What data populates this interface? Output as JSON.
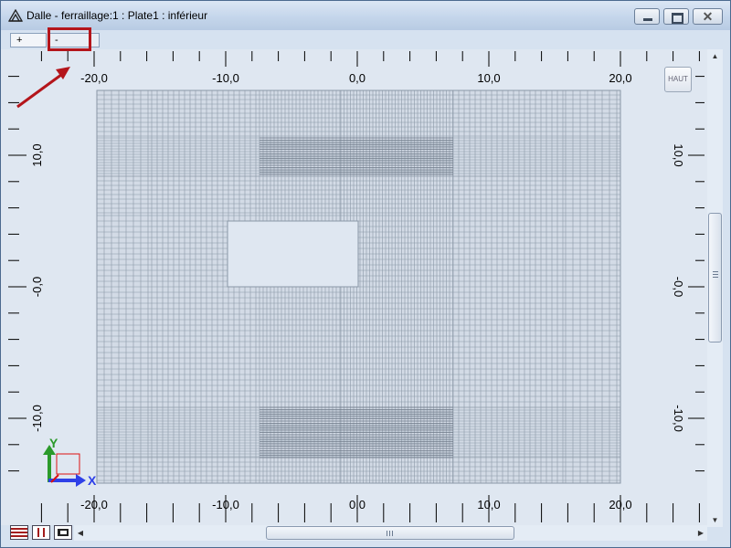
{
  "window": {
    "title": "Dalle - ferraillage:1 : Plate1  : inférieur",
    "icon": "structure-icon",
    "controls": {
      "minimize": "minimize-icon",
      "maximize": "maximize-icon",
      "close_label": "✕"
    }
  },
  "tabs": [
    {
      "label": "+"
    },
    {
      "label": "-"
    }
  ],
  "canvas": {
    "x_ticks_top": [
      "-20,0",
      "-10,0",
      "0,0",
      "10,0",
      "20,0"
    ],
    "x_ticks_bottom": [
      "-20,0",
      "-10,0",
      "0,0",
      "10,0",
      "20,0"
    ],
    "y_ticks_left": [
      "10,0",
      "-0,0",
      "-10,0"
    ],
    "y_ticks_right": [
      "10,0",
      "-0,0",
      "-10,0"
    ],
    "x_values": [
      -20,
      -10,
      0,
      10,
      20
    ],
    "y_values": [
      10,
      0,
      -10
    ],
    "view_cube_label": "HAUT",
    "axis_labels": {
      "x": "X",
      "y": "Y"
    }
  },
  "colors": {
    "canvas_bg": "#dfe7f1",
    "mesh_line": "#8a97a6",
    "mesh_dense": "#6f7a88",
    "highlight": "#b4151b",
    "x_axis": "#2e40e8",
    "y_axis": "#2b9a2b"
  },
  "scrollbars": {
    "horizontal_grip": "|||",
    "vertical_grip": "≡"
  },
  "view_buttons": [
    "horizontal-bars-icon",
    "vertical-bars-icon",
    "section-icon"
  ]
}
